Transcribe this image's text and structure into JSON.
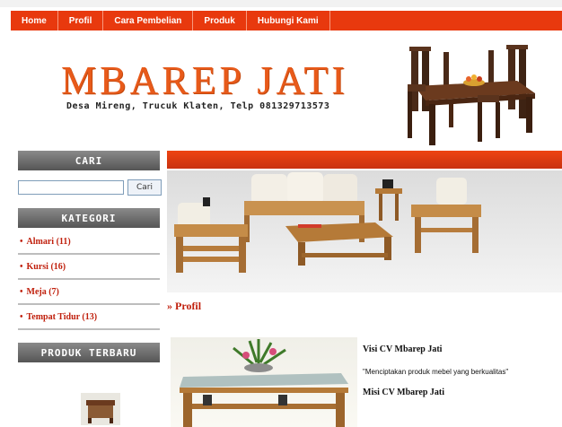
{
  "nav": {
    "items": [
      "Home",
      "Profil",
      "Cara Pembelian",
      "Produk",
      "Hubungi Kami"
    ]
  },
  "header": {
    "title": "MBAREP JATI",
    "address": "Desa Mireng, Trucuk Klaten, Telp 081329713573"
  },
  "sidebar": {
    "search_heading": "CARI",
    "search_placeholder": "",
    "search_button": "Cari",
    "category_heading": "KATEGORI",
    "categories": [
      "Almari (11)",
      "Kursi (16)",
      "Meja (7)",
      "Tempat Tidur (13)"
    ],
    "new_products_heading": "PRODUK TERBARU"
  },
  "main": {
    "section_link": "» Profil",
    "visi_title": "Visi CV Mbarep Jati",
    "visi_text": "\"Menciptakan produk mebel yang berkualitas\"",
    "misi_title": "Misi CV Mbarep Jati"
  },
  "colors": {
    "accent": "#e8390e",
    "link": "#c0200d",
    "logo": "#e85a1a"
  }
}
